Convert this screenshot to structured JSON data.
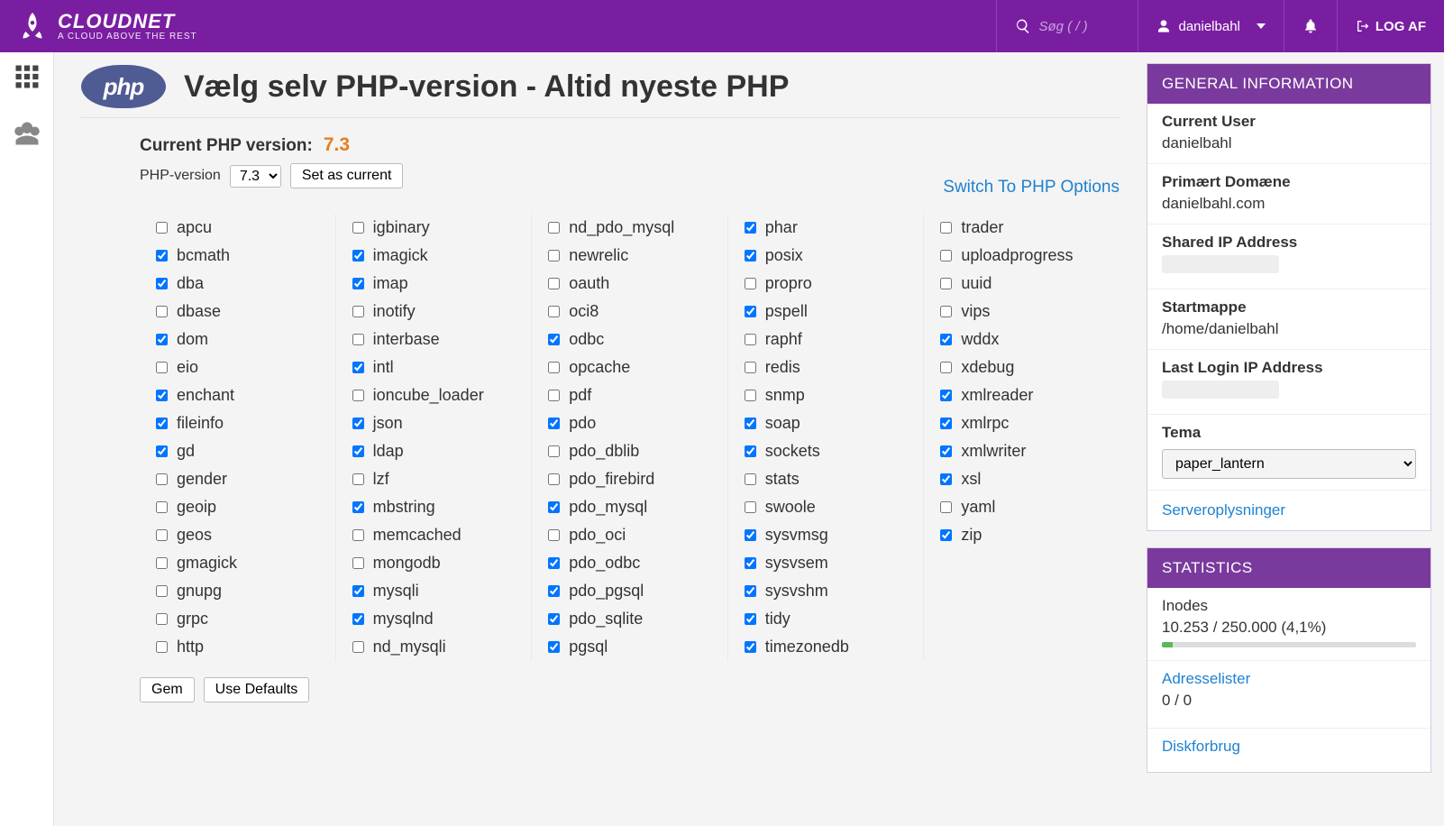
{
  "brand": {
    "name": "CLOUDNET",
    "tagline": "A CLOUD ABOVE THE REST"
  },
  "header": {
    "search_placeholder": "Søg ( / )",
    "user": "danielbahl",
    "logout": "LOG AF"
  },
  "page": {
    "title": "Vælg selv PHP-version - Altid nyeste PHP",
    "current_version_label": "Current PHP version:",
    "current_version": "7.3",
    "php_version_label": "PHP-version",
    "selected_version": "7.3",
    "set_as_current": "Set as current",
    "switch_link": "Switch To PHP Options",
    "save": "Gem",
    "use_defaults": "Use Defaults"
  },
  "extensions": [
    [
      {
        "name": "apcu",
        "on": false
      },
      {
        "name": "bcmath",
        "on": true
      },
      {
        "name": "dba",
        "on": true
      },
      {
        "name": "dbase",
        "on": false
      },
      {
        "name": "dom",
        "on": true
      },
      {
        "name": "eio",
        "on": false
      },
      {
        "name": "enchant",
        "on": true
      },
      {
        "name": "fileinfo",
        "on": true
      },
      {
        "name": "gd",
        "on": true
      },
      {
        "name": "gender",
        "on": false
      },
      {
        "name": "geoip",
        "on": false
      },
      {
        "name": "geos",
        "on": false
      },
      {
        "name": "gmagick",
        "on": false
      },
      {
        "name": "gnupg",
        "on": false
      },
      {
        "name": "grpc",
        "on": false
      },
      {
        "name": "http",
        "on": false
      }
    ],
    [
      {
        "name": "igbinary",
        "on": false
      },
      {
        "name": "imagick",
        "on": true
      },
      {
        "name": "imap",
        "on": true
      },
      {
        "name": "inotify",
        "on": false
      },
      {
        "name": "interbase",
        "on": false
      },
      {
        "name": "intl",
        "on": true
      },
      {
        "name": "ioncube_loader",
        "on": false
      },
      {
        "name": "json",
        "on": true
      },
      {
        "name": "ldap",
        "on": true
      },
      {
        "name": "lzf",
        "on": false
      },
      {
        "name": "mbstring",
        "on": true
      },
      {
        "name": "memcached",
        "on": false
      },
      {
        "name": "mongodb",
        "on": false
      },
      {
        "name": "mysqli",
        "on": true
      },
      {
        "name": "mysqlnd",
        "on": true
      },
      {
        "name": "nd_mysqli",
        "on": false
      }
    ],
    [
      {
        "name": "nd_pdo_mysql",
        "on": false
      },
      {
        "name": "newrelic",
        "on": false
      },
      {
        "name": "oauth",
        "on": false
      },
      {
        "name": "oci8",
        "on": false
      },
      {
        "name": "odbc",
        "on": true
      },
      {
        "name": "opcache",
        "on": false
      },
      {
        "name": "pdf",
        "on": false
      },
      {
        "name": "pdo",
        "on": true
      },
      {
        "name": "pdo_dblib",
        "on": false
      },
      {
        "name": "pdo_firebird",
        "on": false
      },
      {
        "name": "pdo_mysql",
        "on": true
      },
      {
        "name": "pdo_oci",
        "on": false
      },
      {
        "name": "pdo_odbc",
        "on": true
      },
      {
        "name": "pdo_pgsql",
        "on": true
      },
      {
        "name": "pdo_sqlite",
        "on": true
      },
      {
        "name": "pgsql",
        "on": true
      }
    ],
    [
      {
        "name": "phar",
        "on": true
      },
      {
        "name": "posix",
        "on": true
      },
      {
        "name": "propro",
        "on": false
      },
      {
        "name": "pspell",
        "on": true
      },
      {
        "name": "raphf",
        "on": false
      },
      {
        "name": "redis",
        "on": false
      },
      {
        "name": "snmp",
        "on": false
      },
      {
        "name": "soap",
        "on": true
      },
      {
        "name": "sockets",
        "on": true
      },
      {
        "name": "stats",
        "on": false
      },
      {
        "name": "swoole",
        "on": false
      },
      {
        "name": "sysvmsg",
        "on": true
      },
      {
        "name": "sysvsem",
        "on": true
      },
      {
        "name": "sysvshm",
        "on": true
      },
      {
        "name": "tidy",
        "on": true
      },
      {
        "name": "timezonedb",
        "on": true
      }
    ],
    [
      {
        "name": "trader",
        "on": false
      },
      {
        "name": "uploadprogress",
        "on": false
      },
      {
        "name": "uuid",
        "on": false
      },
      {
        "name": "vips",
        "on": false
      },
      {
        "name": "wddx",
        "on": true
      },
      {
        "name": "xdebug",
        "on": false
      },
      {
        "name": "xmlreader",
        "on": true
      },
      {
        "name": "xmlrpc",
        "on": true
      },
      {
        "name": "xmlwriter",
        "on": true
      },
      {
        "name": "xsl",
        "on": true
      },
      {
        "name": "yaml",
        "on": false
      },
      {
        "name": "zip",
        "on": true
      }
    ]
  ],
  "general_info": {
    "heading": "GENERAL INFORMATION",
    "current_user_label": "Current User",
    "current_user": "danielbahl",
    "primary_domain_label": "Primært Domæne",
    "primary_domain": "danielbahl.com",
    "shared_ip_label": "Shared IP Address",
    "home_label": "Startmappe",
    "home": "/home/danielbahl",
    "last_login_label": "Last Login IP Address",
    "theme_label": "Tema",
    "theme_value": "paper_lantern",
    "server_info_link": "Serveroplysninger"
  },
  "stats": {
    "heading": "STATISTICS",
    "inodes_label": "Inodes",
    "inodes_value": "10.253 / 250.000   (4,1%)",
    "inodes_pct": 4.1,
    "addr_label": "Adresselister",
    "addr_value": "0 / 0",
    "disk_label": "Diskforbrug"
  }
}
